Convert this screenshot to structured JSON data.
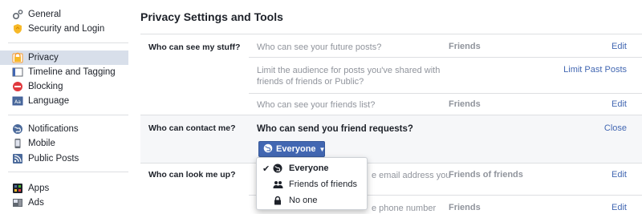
{
  "sidebar": {
    "items": [
      {
        "label": "General",
        "icon": "gear-icon"
      },
      {
        "label": "Security and Login",
        "icon": "shield-icon"
      },
      {
        "label": "Privacy",
        "icon": "lock-icon",
        "active": true
      },
      {
        "label": "Timeline and Tagging",
        "icon": "timeline-icon"
      },
      {
        "label": "Blocking",
        "icon": "blocking-icon"
      },
      {
        "label": "Language",
        "icon": "language-icon"
      },
      {
        "label": "Notifications",
        "icon": "globe-icon"
      },
      {
        "label": "Mobile",
        "icon": "mobile-icon"
      },
      {
        "label": "Public Posts",
        "icon": "rss-icon"
      },
      {
        "label": "Apps",
        "icon": "apps-icon"
      },
      {
        "label": "Ads",
        "icon": "ads-icon"
      }
    ]
  },
  "main": {
    "title": "Privacy Settings and Tools",
    "sections": [
      {
        "label": "Who can see my stuff?",
        "rows": [
          {
            "question": "Who can see your future posts?",
            "value": "Friends",
            "action": "Edit"
          },
          {
            "question_line1": "Limit the audience for posts you've shared with",
            "question_line2": "friends of friends or Public?",
            "value": "",
            "action": "Limit Past Posts"
          },
          {
            "question": "Who can see your friends list?",
            "value": "Friends",
            "action": "Edit"
          }
        ]
      },
      {
        "label": "Who can contact me?",
        "rows": [
          {
            "question": "Who can send you friend requests?",
            "value": "",
            "action": "Close"
          }
        ]
      },
      {
        "label": "Who can look me up?",
        "rows": [
          {
            "question_tail": "e email address you",
            "value": "Friends of friends",
            "action": "Edit"
          },
          {
            "question_tail": "e phone number",
            "value": "Friends",
            "action": "Edit"
          }
        ]
      }
    ],
    "dropdown": {
      "selected": "Everyone",
      "options": [
        {
          "label": "Everyone",
          "icon": "globe-icon",
          "checked": true
        },
        {
          "label": "Friends of friends",
          "icon": "friends-icon",
          "checked": false
        },
        {
          "label": "No one",
          "icon": "lock-icon",
          "checked": false
        }
      ]
    }
  },
  "colors": {
    "accent": "#4267b2",
    "active_bg": "#d8dfea",
    "muted_text": "#90949c",
    "highlight_row": "#f6f7f9"
  }
}
